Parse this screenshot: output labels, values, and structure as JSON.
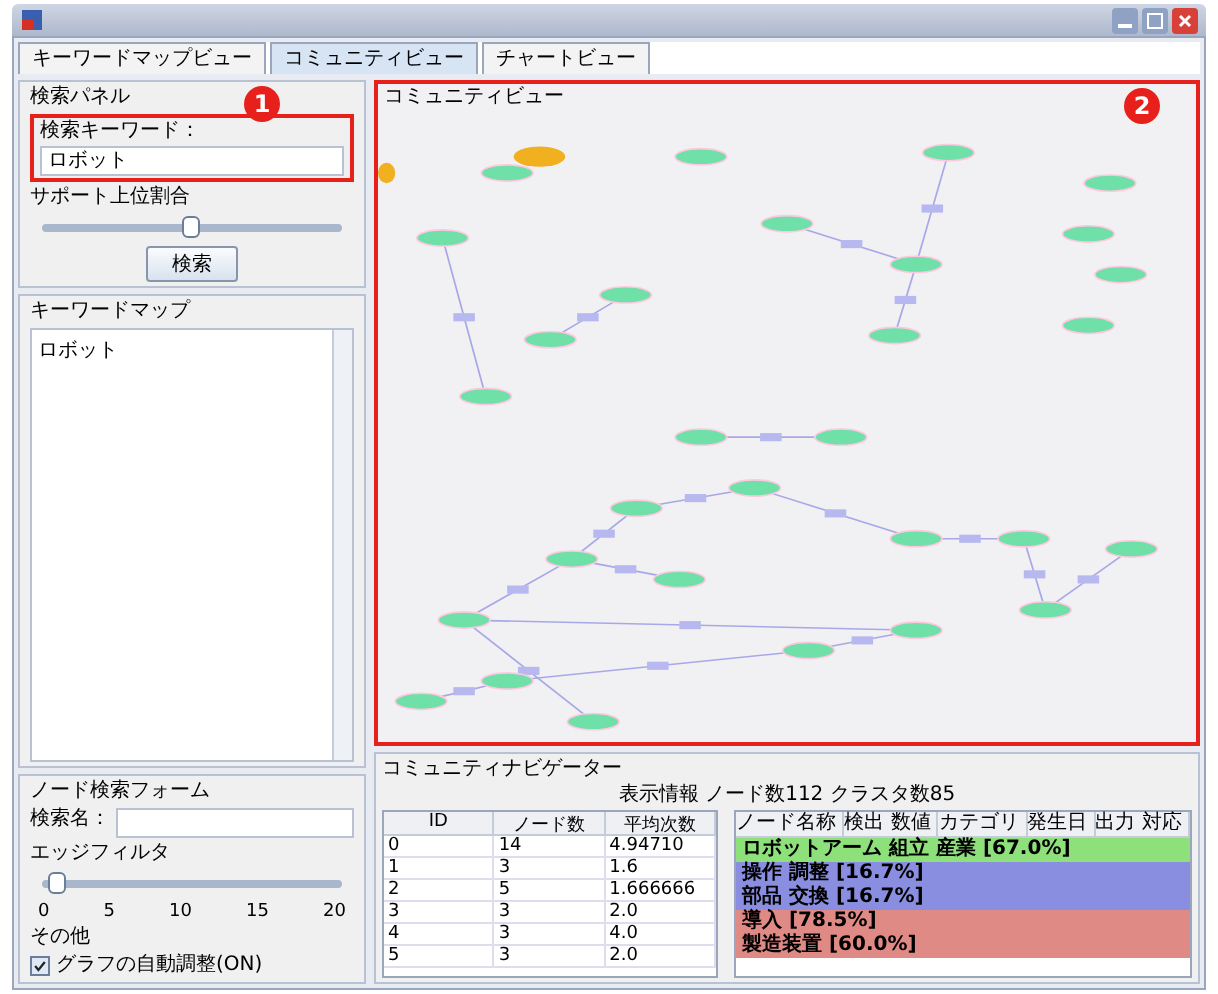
{
  "tabs": [
    {
      "label": "キーワードマップビュー",
      "selected": false
    },
    {
      "label": "コミュニティビュー",
      "selected": true
    },
    {
      "label": "チャートビュー",
      "selected": false
    }
  ],
  "search_panel": {
    "title": "検索パネル",
    "keyword_label": "検索キーワード：",
    "keyword_value": "ロボット",
    "support_label": "サポート上位割合",
    "level": 0.5,
    "button": "検索"
  },
  "callouts": [
    "1",
    "2"
  ],
  "keyword_map": {
    "title": "キーワードマップ",
    "items": [
      {
        "label": "ロボット",
        "selected": false
      }
    ]
  },
  "node_search": {
    "title": "ノード検索フォーム",
    "name_label": "検索名：",
    "edge_filter_label": "エッジフィルタ",
    "level": 0.05,
    "ticks": [
      "0",
      "5",
      "10",
      "15",
      "20"
    ],
    "other_label": "その他",
    "checkbox": {
      "label": "グラフの自動調整(ON)",
      "checked": true
    }
  },
  "community_view": {
    "title": "コミュニティビュー"
  },
  "navigator": {
    "title": "コミュニティナビゲーター",
    "summary": "表示情報 ノード数112 クラスタ数85",
    "columns": [
      "ID",
      "ノード数",
      "平均次数"
    ],
    "rows": [
      [
        "0",
        "14",
        "4.94710"
      ],
      [
        "1",
        "3",
        "1.6"
      ],
      [
        "2",
        "5",
        "1.666666"
      ],
      [
        "3",
        "3",
        "2.0"
      ],
      [
        "4",
        "3",
        "4.0"
      ],
      [
        "5",
        "3",
        "2.0"
      ]
    ],
    "detail_columns": [
      "ノード名称",
      "検出 数値",
      "カテゴリ",
      "発生日",
      "出力 対応"
    ],
    "clusters": [
      {
        "label": "ロボットアーム 組立 産業 [67.0%]",
        "color": "#8ee07a"
      },
      {
        "label": "操作 調整 [16.7%]",
        "color": "#8a8ee0"
      },
      {
        "label": "部品 交換 [16.7%]",
        "color": "#8a8ee0"
      },
      {
        "label": "導入 [78.5%]",
        "color": "#e08a86"
      },
      {
        "label": "製造装置 [60.0%]",
        "color": "#e08a86"
      }
    ]
  }
}
